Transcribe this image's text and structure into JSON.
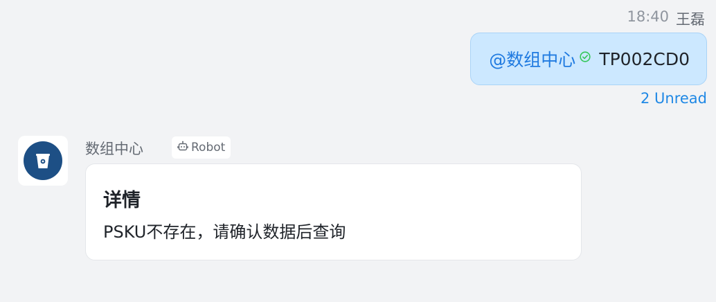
{
  "outgoing": {
    "time": "18:40",
    "sender": "王磊",
    "mention": "@数组中心",
    "text": "TP002CD0",
    "read_status": "2 Unread"
  },
  "incoming": {
    "sender": "数组中心",
    "badge_label": "Robot",
    "card": {
      "title": "详情",
      "body": "PSKU不存在，请确认数据后查询"
    }
  },
  "colors": {
    "background": "#f2f3f5",
    "outgoing_bubble": "#cce8ff",
    "mention": "#1f7ae0",
    "check": "#34c759",
    "unread": "#1f88e5",
    "avatar": "#1d4f85"
  },
  "icons": {
    "check": "check-circle-icon",
    "avatar": "bucket-icon",
    "robot": "robot-icon"
  }
}
